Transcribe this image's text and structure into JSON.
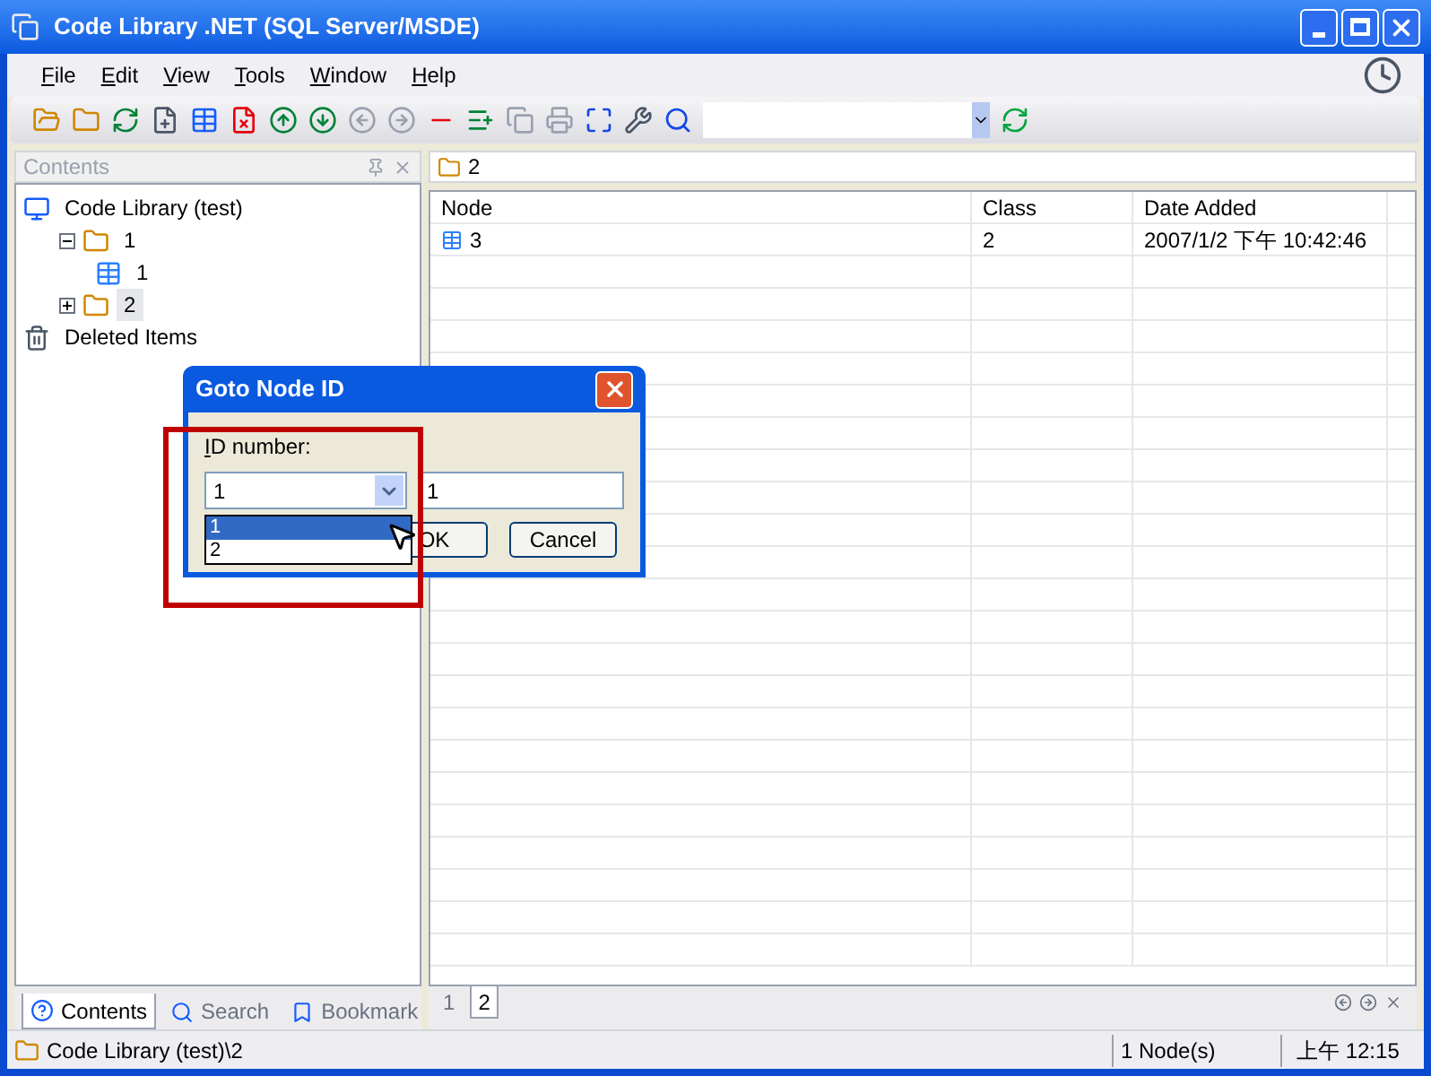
{
  "window": {
    "title": "Code Library .NET (SQL Server/MSDE)"
  },
  "menu": [
    "File",
    "Edit",
    "View",
    "Tools",
    "Window",
    "Help"
  ],
  "contents_panel": {
    "title": "Contents",
    "tree": [
      {
        "label": "Code Library (test)",
        "kind": "root",
        "selected": false,
        "children": [
          {
            "label": "1",
            "kind": "folder",
            "selected": false,
            "expanded": true,
            "children": [
              {
                "label": "1",
                "kind": "table",
                "selected": false
              }
            ]
          },
          {
            "label": "2",
            "kind": "folder",
            "selected": true,
            "expanded": false
          }
        ]
      },
      {
        "label": "Deleted Items",
        "kind": "trash",
        "selected": false
      }
    ],
    "tabs": [
      {
        "label": "Contents",
        "selected": true
      },
      {
        "label": "Search",
        "selected": false
      },
      {
        "label": "Bookmark",
        "selected": false
      }
    ]
  },
  "document": {
    "title": "2",
    "table": {
      "columns": [
        "Node",
        "Class",
        "Date Added"
      ],
      "rows": [
        [
          "3",
          "2",
          "2007/1/2 下午 10:42:46"
        ]
      ]
    },
    "tabs": [
      {
        "label": "1",
        "selected": false
      },
      {
        "label": "2",
        "selected": true
      }
    ]
  },
  "dialog": {
    "title": "Goto Node ID",
    "label": "ID number:",
    "combo_value": "1",
    "text_value": "1",
    "options": [
      {
        "label": "1",
        "selected": true
      },
      {
        "label": "2",
        "selected": false
      }
    ],
    "buttons": [
      "OK",
      "Cancel"
    ]
  },
  "status_bar": {
    "path": "Code Library (test)\\2",
    "count": "1 Node(s)",
    "time": "上午 12:15"
  }
}
